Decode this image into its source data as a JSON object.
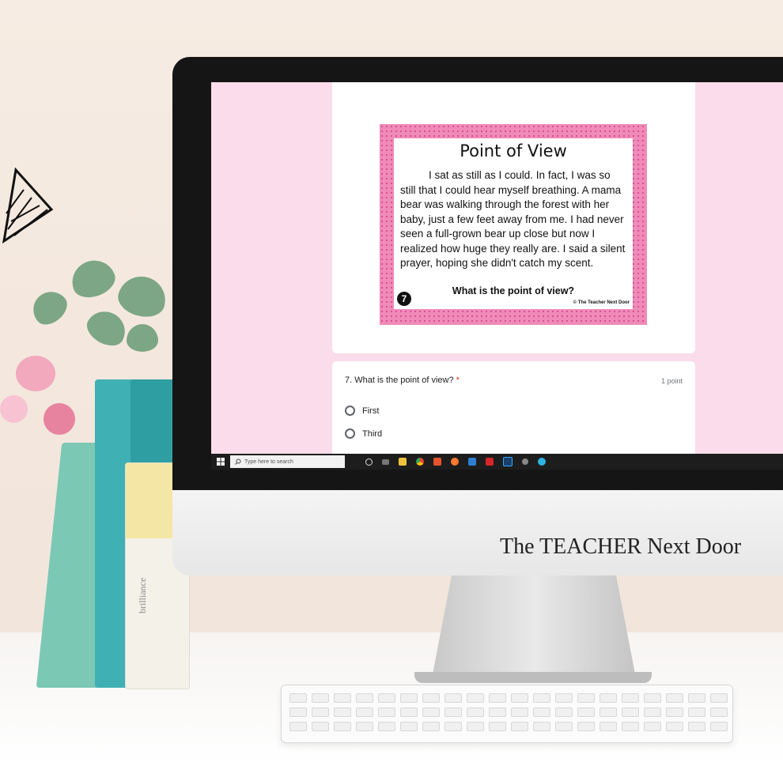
{
  "screen": {
    "poster": {
      "title": "Point of View",
      "passage": "I sat as still as I could. In fact, I was so still that I could hear myself breathing. A mama bear was walking through the forest with her baby, just a few feet away from me. I had never seen a full-grown bear up close but now I realized how huge they really are. I said a silent prayer, hoping she didn't catch my scent.",
      "question": "What is the point of view?",
      "number": "7",
      "copyright": "© The Teacher Next Door"
    },
    "form_question": {
      "label": "7. What is the point of view?",
      "required_mark": "*",
      "points": "1 point",
      "options": [
        {
          "label": "First",
          "selected": false
        },
        {
          "label": "Third",
          "selected": false
        }
      ]
    },
    "taskbar": {
      "search_placeholder": "Type here to search",
      "icons": [
        "cortana-icon",
        "task-view-icon",
        "file-explorer-icon",
        "chrome-icon",
        "office-icon",
        "firefox-icon",
        "mail-icon",
        "acrobat-icon",
        "photoshop-icon",
        "settings-icon",
        "edge-icon"
      ]
    }
  },
  "monitor_brand": "The TEACHER Next Door",
  "book_spine_title": "brilliance",
  "colors": {
    "screen_bg": "#fbdcea",
    "poster_border": "#f08ab8",
    "required": "#d93025"
  }
}
